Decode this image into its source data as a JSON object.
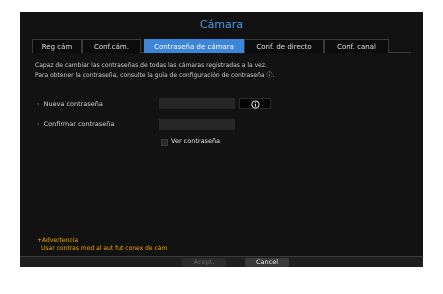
{
  "window": {
    "title": "Cámara"
  },
  "tabs": [
    {
      "label": "Reg cám",
      "active": false
    },
    {
      "label": "Conf.cám.",
      "active": false
    },
    {
      "label": "Contraseña de cámara",
      "active": true
    },
    {
      "label": "Conf. de directo",
      "active": false
    },
    {
      "label": "Conf. canal",
      "active": false
    }
  ],
  "description": {
    "line1": "Capaz de cambiar las contraseñas de todas las cámaras registradas a la vez.",
    "line2": "Para obtener la contraseña, consulte la guía de configuración de contraseña ⓘ."
  },
  "form": {
    "new_password_label": "Nueva contraseña",
    "new_password_value": "",
    "confirm_password_label": "Confirmar contraseña",
    "confirm_password_value": "",
    "show_password_label": "Ver contraseña",
    "show_password_checked": false,
    "info_icon": "info-circle-icon"
  },
  "warning": {
    "title": "+Advertencia",
    "text": "Usar contras mod al aut fut conex de cám"
  },
  "footer": {
    "accept_label": "Acept.",
    "cancel_label": "Cancel"
  },
  "colors": {
    "accent": "#3c86d8",
    "title": "#4f9ae8",
    "warning": "#f0a800",
    "background": "#121212"
  }
}
